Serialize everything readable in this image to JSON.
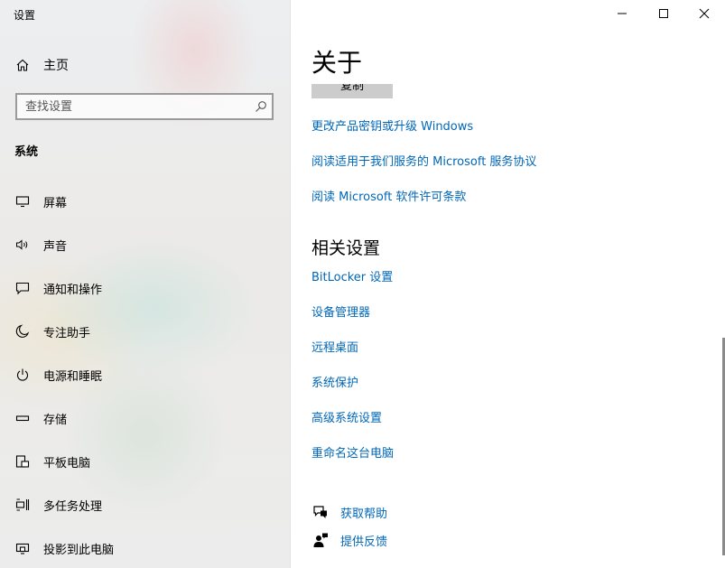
{
  "window": {
    "title": "设置"
  },
  "sidebar": {
    "home_label": "主页",
    "search_placeholder": "查找设置",
    "section_label": "系统",
    "items": [
      {
        "label": "屏幕",
        "icon": "monitor-icon"
      },
      {
        "label": "声音",
        "icon": "speaker-icon"
      },
      {
        "label": "通知和操作",
        "icon": "notification-icon"
      },
      {
        "label": "专注助手",
        "icon": "moon-icon"
      },
      {
        "label": "电源和睡眠",
        "icon": "power-icon"
      },
      {
        "label": "存储",
        "icon": "storage-icon"
      },
      {
        "label": "平板电脑",
        "icon": "tablet-icon"
      },
      {
        "label": "多任务处理",
        "icon": "multitask-icon"
      },
      {
        "label": "投影到此电脑",
        "icon": "project-icon"
      }
    ]
  },
  "titlebar": {
    "minimize_icon": "minimize-icon",
    "maximize_icon": "maximize-icon",
    "close_icon": "close-icon"
  },
  "main": {
    "title": "关于",
    "copy_button_label": "复制",
    "links": [
      "更改产品密钥或升级 Windows",
      "阅读适用于我们服务的 Microsoft 服务协议",
      "阅读 Microsoft 软件许可条款"
    ],
    "related_heading": "相关设置",
    "related_links": [
      "BitLocker 设置",
      "设备管理器",
      "远程桌面",
      "系统保护",
      "高级系统设置",
      "重命名这台电脑"
    ],
    "help": [
      {
        "label": "获取帮助",
        "icon": "help-chat-icon"
      },
      {
        "label": "提供反馈",
        "icon": "feedback-icon"
      }
    ]
  },
  "colors": {
    "link": "#0067b8",
    "sidebar_bg": "#eceef0",
    "main_bg": "#ffffff"
  }
}
